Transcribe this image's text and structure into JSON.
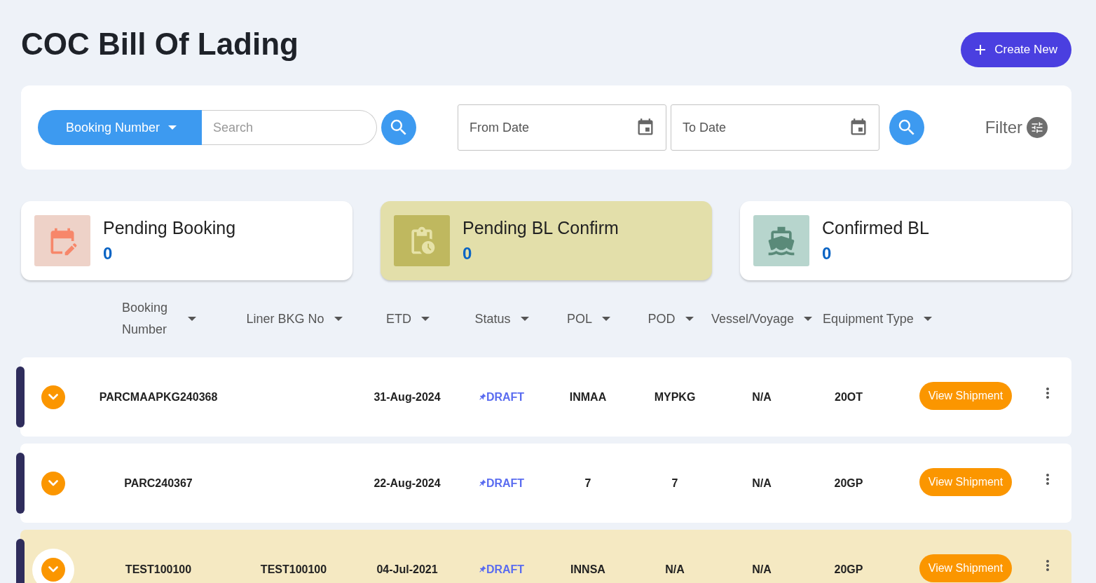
{
  "title": "COC Bill Of Lading",
  "create_button": {
    "label": "Create New"
  },
  "search_bar": {
    "search_by": "Booking Number",
    "placeholder": "Search",
    "from_date": {
      "placeholder": "From Date"
    },
    "to_date": {
      "placeholder": "To Date"
    },
    "filter_label": "Filter"
  },
  "stat_cards": [
    {
      "kind": "booking",
      "title": "Pending Booking",
      "count": "0",
      "color": "#eed2c8",
      "selected": false
    },
    {
      "kind": "pending",
      "title": "Pending BL Confirm",
      "count": "0",
      "color": "#bfb85f",
      "selected": true
    },
    {
      "kind": "confirmed",
      "title": "Confirmed BL",
      "count": "0",
      "color": "#b7d5cd",
      "selected": false
    }
  ],
  "table": {
    "columns": [
      "Booking Number",
      "Liner BKG No",
      "ETD",
      "Status",
      "POL",
      "POD",
      "Vessel/Voyage",
      "Equipment Type"
    ],
    "rows": [
      {
        "booking_number": "PARCMAAPKG240368",
        "liner_bkg_no": "",
        "etd": "31-Aug-2024",
        "status": "DRAFT",
        "pol": "INMAA",
        "pod": "MYPKG",
        "vessel_voyage": "N/A",
        "equipment_type": "20OT",
        "action": "View Shipment",
        "selected": false
      },
      {
        "booking_number": "PARC240367",
        "liner_bkg_no": "",
        "etd": "22-Aug-2024",
        "status": "DRAFT",
        "pol": "7",
        "pod": "7",
        "vessel_voyage": "N/A",
        "equipment_type": "20GP",
        "action": "View Shipment",
        "selected": false
      },
      {
        "booking_number": "TEST100100",
        "liner_bkg_no": "TEST100100",
        "etd": "04-Jul-2021",
        "status": "DRAFT",
        "pol": "INNSA",
        "pod": "N/A",
        "vessel_voyage": "N/A",
        "equipment_type": "20GP",
        "action": "View Shipment",
        "selected": true
      }
    ]
  }
}
